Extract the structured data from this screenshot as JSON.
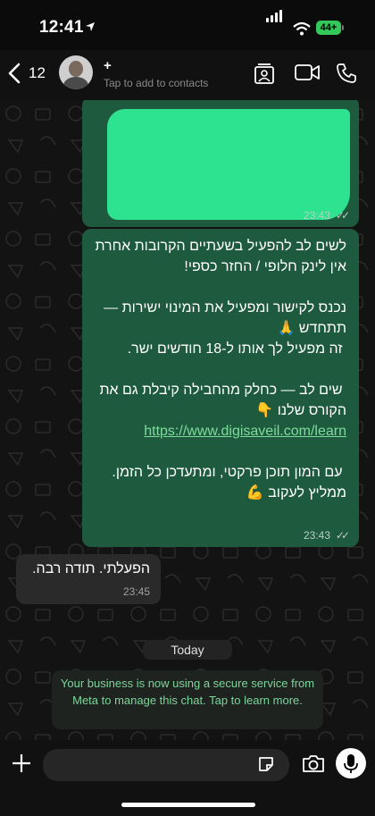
{
  "status_bar": {
    "time": "12:41",
    "battery": "44+"
  },
  "header": {
    "back_count": "12",
    "contact_name": "+",
    "contact_subtitle": "Tap to add to contacts"
  },
  "messages": {
    "m1_time": "23:43",
    "m2_text": "לשים לב להפעיל בשעתיים הקרובות אחרת אין לינק חלופי / החזר כספי!\n\nנכנס לקישור ומפעיל את המינוי ישירות — תתחדש 🙏\n זה מפעיל לך אותו ל-18 חודשים ישר.\n\n שים לב — כחלק מהחבילה קיבלת גם את הקורס שלנו 👇",
    "m2_link": "https://www.digisaveil.com/learn",
    "m2_text_2": "\n עם המון תוכן פרקטי, ומתעדכן כל הזמן. ממליץ לעקוב 💪",
    "m2_time": "23:43",
    "m3_text": "הפעלתי. תודה רבה.",
    "m3_time": "23:45"
  },
  "date_divider": "Today",
  "system_message": "Your business is now using a secure service from Meta to manage this chat. Tap to learn more.",
  "colors": {
    "accent": "#2ee38f",
    "outgoing_bubble": "#1e5a3e",
    "link": "#7fdc9c"
  }
}
